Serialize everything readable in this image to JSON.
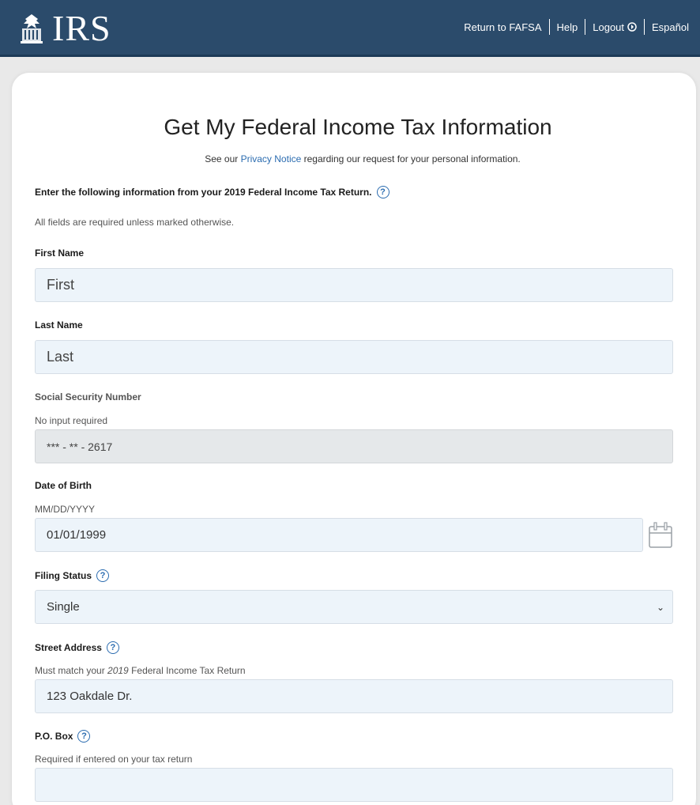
{
  "header": {
    "logo_text": "IRS",
    "nav": {
      "return_fafsa": "Return to FAFSA",
      "help": "Help",
      "logout": "Logout",
      "espanol": "Español"
    }
  },
  "page": {
    "title": "Get My Federal Income Tax Information",
    "privacy_pre": "See our ",
    "privacy_link": "Privacy Notice",
    "privacy_post": " regarding our request for your personal information.",
    "instruction": "Enter the following information from your 2019 Federal Income Tax Return.",
    "required_note": "All fields are required unless marked otherwise."
  },
  "form": {
    "first_name": {
      "label": "First Name",
      "value": "First"
    },
    "last_name": {
      "label": "Last Name",
      "value": "Last"
    },
    "ssn": {
      "label": "Social Security Number",
      "hint": "No input required",
      "value": "*** - ** - 2617"
    },
    "dob": {
      "label": "Date of Birth",
      "hint": "MM/DD/YYYY",
      "value": "01/01/1999"
    },
    "filing_status": {
      "label": "Filing Status",
      "value": "Single"
    },
    "street": {
      "label": "Street Address",
      "hint_pre": "Must match your ",
      "hint_year": "2019",
      "hint_post": " Federal Income Tax Return",
      "value": "123 Oakdale Dr."
    },
    "po_box": {
      "label": "P.O. Box",
      "hint": "Required if entered on your tax return",
      "value": ""
    }
  },
  "icons": {
    "help": "?",
    "logout": "logout-icon",
    "calendar": "calendar-icon",
    "select": "chevron-down-icon"
  },
  "colors": {
    "header_bg": "#2b4b6b",
    "link": "#2b6cb0",
    "field_bg": "#edf4fa",
    "disabled_bg": "#e5e8ea"
  }
}
